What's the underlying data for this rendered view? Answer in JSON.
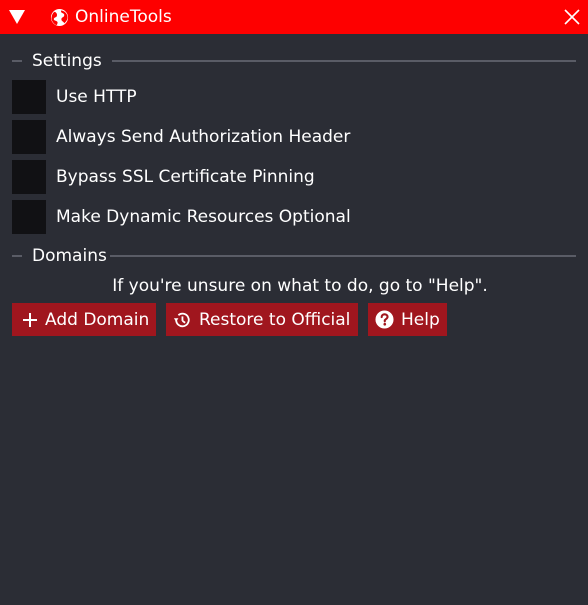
{
  "titlebar": {
    "title": "OnlineTools",
    "collapse_icon": "triangle-down-icon",
    "app_icon": "globe-icon",
    "close_icon": "close-icon",
    "color": "#fe0000"
  },
  "settings": {
    "header": "Settings",
    "options": [
      {
        "label": "Use HTTP",
        "checked": false
      },
      {
        "label": "Always Send Authorization Header",
        "checked": false
      },
      {
        "label": "Bypass SSL Certificate Pinning",
        "checked": false
      },
      {
        "label": "Make Dynamic Resources Optional",
        "checked": false
      }
    ]
  },
  "domains": {
    "header": "Domains",
    "hint": "If you're unsure on what to do, go to \"Help\".",
    "buttons": [
      {
        "label": "Add Domain",
        "icon": "plus-icon"
      },
      {
        "label": "Restore to Official",
        "icon": "history-icon"
      },
      {
        "label": "Help",
        "icon": "question-icon"
      }
    ]
  },
  "colors": {
    "background": "#2b2d35",
    "button": "#a0161e",
    "checkbox": "#111114",
    "divider": "#5a5c66"
  }
}
